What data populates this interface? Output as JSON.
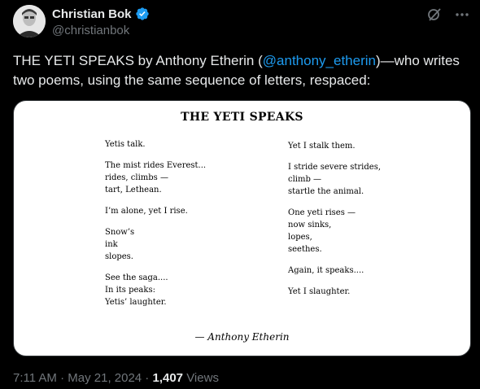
{
  "author": {
    "name": "Christian Bok",
    "handle": "@christianbok"
  },
  "tweet": {
    "text_before": "THE YETI SPEAKS by Anthony Etherin (",
    "mention": "@anthony_etherin",
    "text_after": ")—who writes two poems, using the same sequence of letters, respaced:"
  },
  "poem": {
    "title": "THE YETI SPEAKS",
    "left_stanzas": [
      [
        "Yetis talk."
      ],
      [
        "The mist rides Everest...",
        "rides, climbs —",
        "tart, Lethean."
      ],
      [
        "I’m alone, yet I rise."
      ],
      [
        "Snow’s",
        "ink",
        "slopes."
      ],
      [
        "See the saga....",
        "In its peaks:",
        "Yetis’ laughter."
      ]
    ],
    "right_stanzas": [
      [
        "Yet I stalk them."
      ],
      [
        "I stride severe strides,",
        "climb —",
        "startle the animal."
      ],
      [
        "One yeti rises —",
        "now sinks,",
        "lopes,",
        "seethes."
      ],
      [
        "Again, it speaks...."
      ],
      [
        "Yet I slaughter."
      ]
    ],
    "attribution": "— Anthony Etherin"
  },
  "meta": {
    "time": "7:11 AM · May 21, 2024 · ",
    "views_count": "1,407",
    "views_label": " Views"
  },
  "icons": {
    "verified": "verified-badge-icon",
    "grok": "grok-icon",
    "more": "more-icon"
  },
  "colors": {
    "background": "#000000",
    "text": "#e7e9ea",
    "muted": "#71767b",
    "link": "#1d9bf0"
  }
}
